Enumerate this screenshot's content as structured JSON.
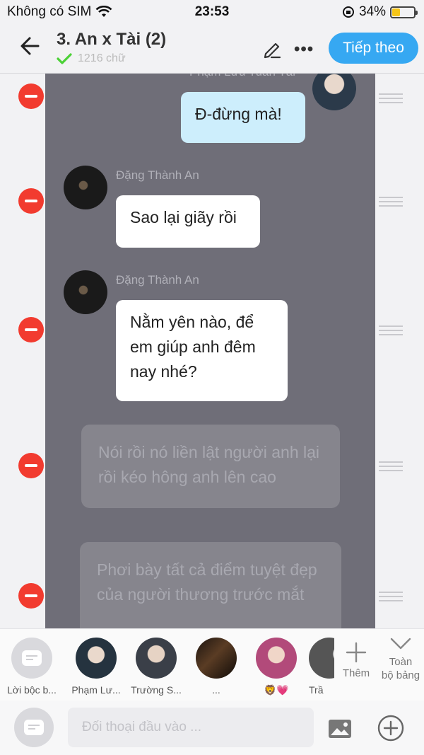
{
  "status_bar": {
    "carrier": "Không có SIM",
    "time": "23:53",
    "battery_text": "34%",
    "battery_level": 0.34
  },
  "header": {
    "title": "3. An x Tài (2)",
    "subtitle": "1216 chữ",
    "next_button": "Tiếp theo"
  },
  "chat": {
    "top_sender": "Phạm Lưu Tuấn Tài",
    "messages": [
      {
        "sender": "",
        "text": "Đ-đừng mà!",
        "style": "blue"
      },
      {
        "sender": "Đặng Thành An",
        "text": "Sao lại giãy rồi",
        "style": "white"
      },
      {
        "sender": "Đặng Thành An",
        "text": "Nằm yên nào, để em giúp anh đêm nay nhé?",
        "style": "white"
      },
      {
        "sender": "",
        "text": "Nói rồi nó liền lật người anh lại rồi kéo hông anh lên cao",
        "style": "narration"
      },
      {
        "sender": "",
        "text": "Phơi bày tất cả điểm tuyệt đẹp của người thương trước mắt",
        "style": "narration"
      }
    ]
  },
  "characters": [
    {
      "name": "Lời bộc b..."
    },
    {
      "name": "Phạm Lư..."
    },
    {
      "name": "Trường S..."
    },
    {
      "name": "..."
    },
    {
      "name": "🦁💗"
    },
    {
      "name": "Trầ"
    }
  ],
  "add_label": "Thêm",
  "all_label_line1": "Toàn",
  "all_label_line2": "bộ bảng",
  "input": {
    "placeholder": "Đối thoại đầu vào ..."
  },
  "colors": {
    "accent": "#36a8f2",
    "delete": "#f23b2f",
    "panel": "#6f6e78",
    "bubble_blue": "#cdeefc",
    "bubble_white": "#ffffff"
  }
}
